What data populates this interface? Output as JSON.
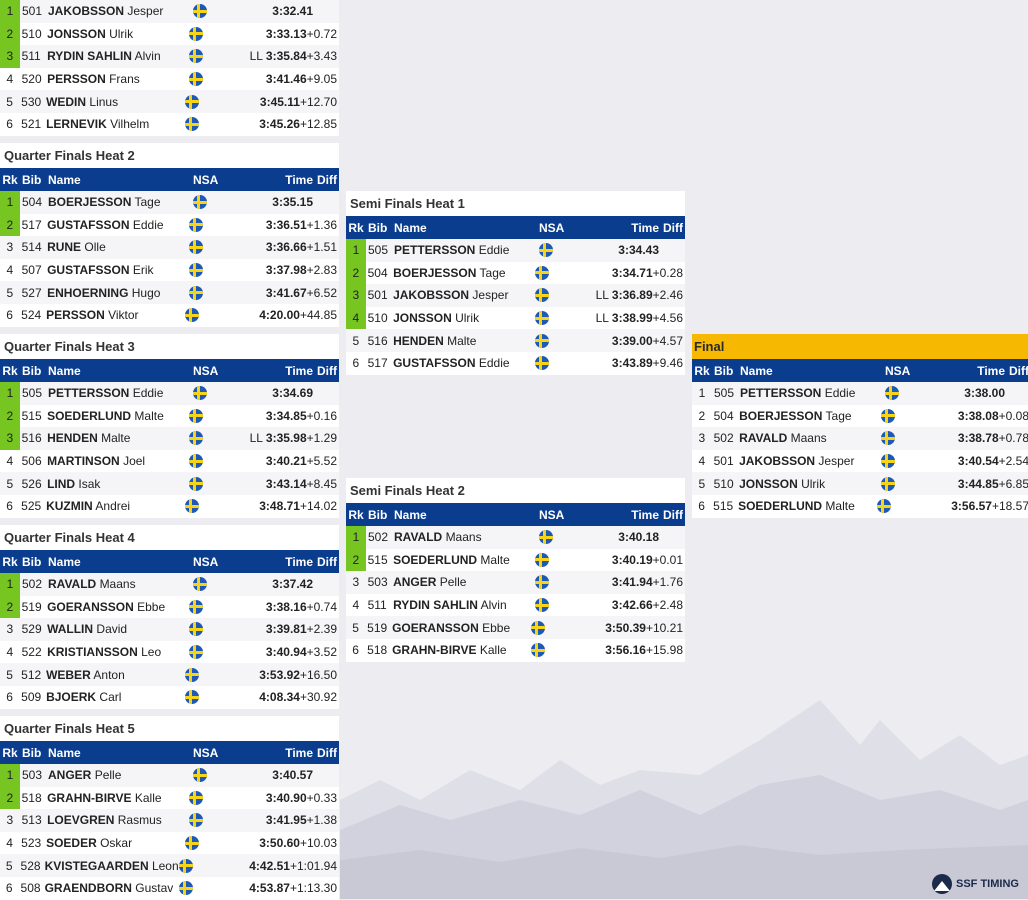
{
  "brand": {
    "logo_text": "SSF TIMING"
  },
  "table_header": {
    "rk": "Rk",
    "bib": "Bib",
    "name": "Name",
    "nsa": "NSA",
    "time": "Time",
    "diff": "Diff"
  },
  "colors": {
    "header_bg": "#0b3d8f",
    "qualified": "#77c520",
    "final_title": "#f6b800",
    "flag_blue": "#1e5ab5",
    "flag_yellow": "#f7d516"
  },
  "heats": [
    {
      "id": "qf1",
      "title": "",
      "rows": [
        {
          "rk": "1",
          "q": true,
          "bib": "501",
          "last": "JAKOBSSON",
          "first": "Jesper",
          "ll": "",
          "time": "3:32.41",
          "diff": ""
        },
        {
          "rk": "2",
          "q": true,
          "bib": "510",
          "last": "JONSSON",
          "first": "Ulrik",
          "ll": "",
          "time": "3:33.13",
          "diff": "+0.72"
        },
        {
          "rk": "3",
          "q": true,
          "bib": "511",
          "last": "RYDIN SAHLIN",
          "first": "Alvin",
          "ll": "LL",
          "time": "3:35.84",
          "diff": "+3.43"
        },
        {
          "rk": "4",
          "q": false,
          "bib": "520",
          "last": "PERSSON",
          "first": "Frans",
          "ll": "",
          "time": "3:41.46",
          "diff": "+9.05"
        },
        {
          "rk": "5",
          "q": false,
          "bib": "530",
          "last": "WEDIN",
          "first": "Linus",
          "ll": "",
          "time": "3:45.11",
          "diff": "+12.70"
        },
        {
          "rk": "6",
          "q": false,
          "bib": "521",
          "last": "LERNEVIK",
          "first": "Vilhelm",
          "ll": "",
          "time": "3:45.26",
          "diff": "+12.85"
        }
      ]
    },
    {
      "id": "qf2",
      "title": "Quarter Finals Heat 2",
      "rows": [
        {
          "rk": "1",
          "q": true,
          "bib": "504",
          "last": "BOERJESSON",
          "first": "Tage",
          "ll": "",
          "time": "3:35.15",
          "diff": ""
        },
        {
          "rk": "2",
          "q": true,
          "bib": "517",
          "last": "GUSTAFSSON",
          "first": "Eddie",
          "ll": "",
          "time": "3:36.51",
          "diff": "+1.36"
        },
        {
          "rk": "3",
          "q": false,
          "bib": "514",
          "last": "RUNE",
          "first": "Olle",
          "ll": "",
          "time": "3:36.66",
          "diff": "+1.51"
        },
        {
          "rk": "4",
          "q": false,
          "bib": "507",
          "last": "GUSTAFSSON",
          "first": "Erik",
          "ll": "",
          "time": "3:37.98",
          "diff": "+2.83"
        },
        {
          "rk": "5",
          "q": false,
          "bib": "527",
          "last": "ENHOERNING",
          "first": "Hugo",
          "ll": "",
          "time": "3:41.67",
          "diff": "+6.52"
        },
        {
          "rk": "6",
          "q": false,
          "bib": "524",
          "last": "PERSSON",
          "first": "Viktor",
          "ll": "",
          "time": "4:20.00",
          "diff": "+44.85"
        }
      ]
    },
    {
      "id": "qf3",
      "title": "Quarter Finals Heat 3",
      "rows": [
        {
          "rk": "1",
          "q": true,
          "bib": "505",
          "last": "PETTERSSON",
          "first": "Eddie",
          "ll": "",
          "time": "3:34.69",
          "diff": ""
        },
        {
          "rk": "2",
          "q": true,
          "bib": "515",
          "last": "SOEDERLUND",
          "first": "Malte",
          "ll": "",
          "time": "3:34.85",
          "diff": "+0.16"
        },
        {
          "rk": "3",
          "q": true,
          "bib": "516",
          "last": "HENDEN",
          "first": "Malte",
          "ll": "LL",
          "time": "3:35.98",
          "diff": "+1.29"
        },
        {
          "rk": "4",
          "q": false,
          "bib": "506",
          "last": "MARTINSON",
          "first": "Joel",
          "ll": "",
          "time": "3:40.21",
          "diff": "+5.52"
        },
        {
          "rk": "5",
          "q": false,
          "bib": "526",
          "last": "LIND",
          "first": "Isak",
          "ll": "",
          "time": "3:43.14",
          "diff": "+8.45"
        },
        {
          "rk": "6",
          "q": false,
          "bib": "525",
          "last": "KUZMIN",
          "first": "Andrei",
          "ll": "",
          "time": "3:48.71",
          "diff": "+14.02"
        }
      ]
    },
    {
      "id": "qf4",
      "title": "Quarter Finals Heat 4",
      "rows": [
        {
          "rk": "1",
          "q": true,
          "bib": "502",
          "last": "RAVALD",
          "first": "Maans",
          "ll": "",
          "time": "3:37.42",
          "diff": ""
        },
        {
          "rk": "2",
          "q": true,
          "bib": "519",
          "last": "GOERANSSON",
          "first": "Ebbe",
          "ll": "",
          "time": "3:38.16",
          "diff": "+0.74"
        },
        {
          "rk": "3",
          "q": false,
          "bib": "529",
          "last": "WALLIN",
          "first": "David",
          "ll": "",
          "time": "3:39.81",
          "diff": "+2.39"
        },
        {
          "rk": "4",
          "q": false,
          "bib": "522",
          "last": "KRISTIANSSON",
          "first": "Leo",
          "ll": "",
          "time": "3:40.94",
          "diff": "+3.52"
        },
        {
          "rk": "5",
          "q": false,
          "bib": "512",
          "last": "WEBER",
          "first": "Anton",
          "ll": "",
          "time": "3:53.92",
          "diff": "+16.50"
        },
        {
          "rk": "6",
          "q": false,
          "bib": "509",
          "last": "BJOERK",
          "first": "Carl",
          "ll": "",
          "time": "4:08.34",
          "diff": "+30.92"
        }
      ]
    },
    {
      "id": "qf5",
      "title": "Quarter Finals Heat 5",
      "rows": [
        {
          "rk": "1",
          "q": true,
          "bib": "503",
          "last": "ANGER",
          "first": "Pelle",
          "ll": "",
          "time": "3:40.57",
          "diff": ""
        },
        {
          "rk": "2",
          "q": true,
          "bib": "518",
          "last": "GRAHN-BIRVE",
          "first": "Kalle",
          "ll": "",
          "time": "3:40.90",
          "diff": "+0.33"
        },
        {
          "rk": "3",
          "q": false,
          "bib": "513",
          "last": "LOEVGREN",
          "first": "Rasmus",
          "ll": "",
          "time": "3:41.95",
          "diff": "+1.38"
        },
        {
          "rk": "4",
          "q": false,
          "bib": "523",
          "last": "SOEDER",
          "first": "Oskar",
          "ll": "",
          "time": "3:50.60",
          "diff": "+10.03"
        },
        {
          "rk": "5",
          "q": false,
          "bib": "528",
          "last": "KVISTEGAARDEN",
          "first": "Leon",
          "ll": "",
          "time": "4:42.51",
          "diff": "+1:01.94"
        },
        {
          "rk": "6",
          "q": false,
          "bib": "508",
          "last": "GRAENDBORN",
          "first": "Gustav",
          "ll": "",
          "time": "4:53.87",
          "diff": "+1:13.30"
        }
      ]
    },
    {
      "id": "sf1",
      "title": "Semi Finals Heat 1",
      "rows": [
        {
          "rk": "1",
          "q": true,
          "bib": "505",
          "last": "PETTERSSON",
          "first": "Eddie",
          "ll": "",
          "time": "3:34.43",
          "diff": ""
        },
        {
          "rk": "2",
          "q": true,
          "bib": "504",
          "last": "BOERJESSON",
          "first": "Tage",
          "ll": "",
          "time": "3:34.71",
          "diff": "+0.28"
        },
        {
          "rk": "3",
          "q": true,
          "bib": "501",
          "last": "JAKOBSSON",
          "first": "Jesper",
          "ll": "LL",
          "time": "3:36.89",
          "diff": "+2.46"
        },
        {
          "rk": "4",
          "q": true,
          "bib": "510",
          "last": "JONSSON",
          "first": "Ulrik",
          "ll": "LL",
          "time": "3:38.99",
          "diff": "+4.56"
        },
        {
          "rk": "5",
          "q": false,
          "bib": "516",
          "last": "HENDEN",
          "first": "Malte",
          "ll": "",
          "time": "3:39.00",
          "diff": "+4.57"
        },
        {
          "rk": "6",
          "q": false,
          "bib": "517",
          "last": "GUSTAFSSON",
          "first": "Eddie",
          "ll": "",
          "time": "3:43.89",
          "diff": "+9.46"
        }
      ]
    },
    {
      "id": "sf2",
      "title": "Semi Finals Heat 2",
      "rows": [
        {
          "rk": "1",
          "q": true,
          "bib": "502",
          "last": "RAVALD",
          "first": "Maans",
          "ll": "",
          "time": "3:40.18",
          "diff": ""
        },
        {
          "rk": "2",
          "q": true,
          "bib": "515",
          "last": "SOEDERLUND",
          "first": "Malte",
          "ll": "",
          "time": "3:40.19",
          "diff": "+0.01"
        },
        {
          "rk": "3",
          "q": false,
          "bib": "503",
          "last": "ANGER",
          "first": "Pelle",
          "ll": "",
          "time": "3:41.94",
          "diff": "+1.76"
        },
        {
          "rk": "4",
          "q": false,
          "bib": "511",
          "last": "RYDIN SAHLIN",
          "first": "Alvin",
          "ll": "",
          "time": "3:42.66",
          "diff": "+2.48"
        },
        {
          "rk": "5",
          "q": false,
          "bib": "519",
          "last": "GOERANSSON",
          "first": "Ebbe",
          "ll": "",
          "time": "3:50.39",
          "diff": "+10.21"
        },
        {
          "rk": "6",
          "q": false,
          "bib": "518",
          "last": "GRAHN-BIRVE",
          "first": "Kalle",
          "ll": "",
          "time": "3:56.16",
          "diff": "+15.98"
        }
      ]
    },
    {
      "id": "final",
      "title": "Final",
      "rows": [
        {
          "rk": "1",
          "q": false,
          "bib": "505",
          "last": "PETTERSSON",
          "first": "Eddie",
          "ll": "",
          "time": "3:38.00",
          "diff": ""
        },
        {
          "rk": "2",
          "q": false,
          "bib": "504",
          "last": "BOERJESSON",
          "first": "Tage",
          "ll": "",
          "time": "3:38.08",
          "diff": "+0.08"
        },
        {
          "rk": "3",
          "q": false,
          "bib": "502",
          "last": "RAVALD",
          "first": "Maans",
          "ll": "",
          "time": "3:38.78",
          "diff": "+0.78"
        },
        {
          "rk": "4",
          "q": false,
          "bib": "501",
          "last": "JAKOBSSON",
          "first": "Jesper",
          "ll": "",
          "time": "3:40.54",
          "diff": "+2.54"
        },
        {
          "rk": "5",
          "q": false,
          "bib": "510",
          "last": "JONSSON",
          "first": "Ulrik",
          "ll": "",
          "time": "3:44.85",
          "diff": "+6.85"
        },
        {
          "rk": "6",
          "q": false,
          "bib": "515",
          "last": "SOEDERLUND",
          "first": "Malte",
          "ll": "",
          "time": "3:56.57",
          "diff": "+18.57"
        }
      ]
    }
  ]
}
